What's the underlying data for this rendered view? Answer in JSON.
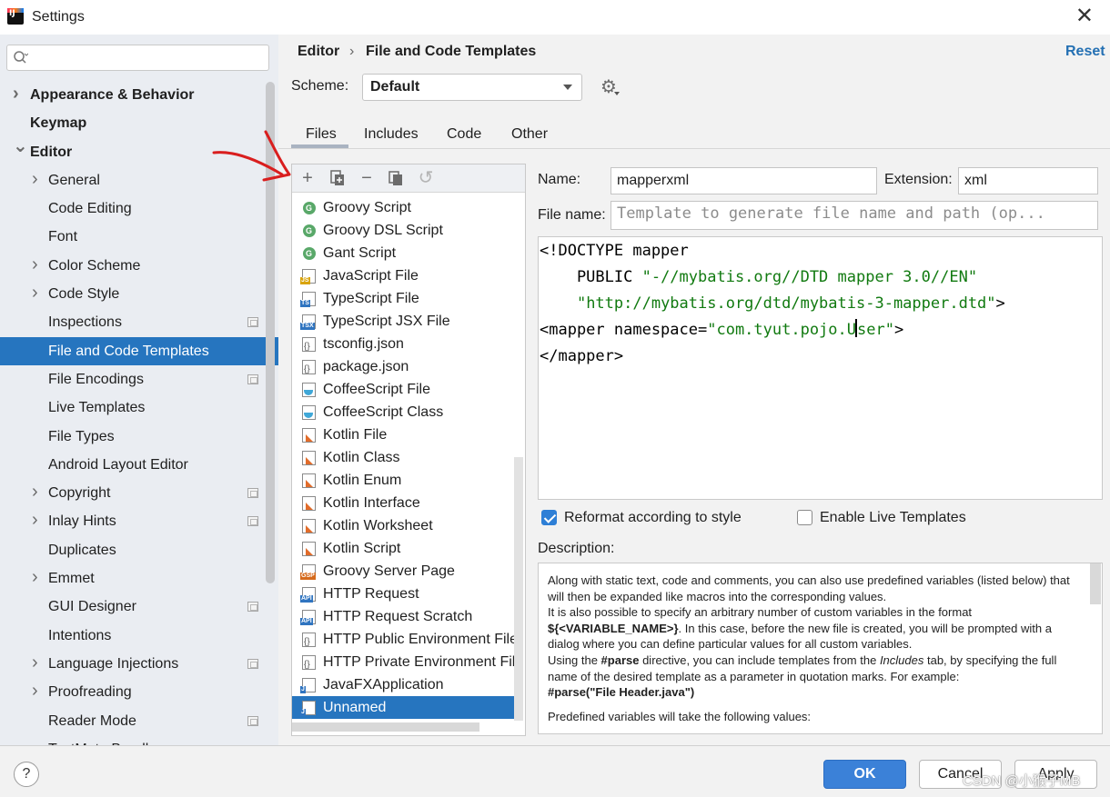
{
  "window": {
    "title": "Settings",
    "close_glyph": "✕"
  },
  "sidebar": {
    "search_placeholder": "",
    "items": [
      {
        "label": "Appearance & Behavior",
        "bold": true,
        "chevron": "right",
        "level": 0
      },
      {
        "label": "Keymap",
        "bold": true,
        "chevron": "none",
        "level": 0
      },
      {
        "label": "Editor",
        "bold": true,
        "chevron": "down",
        "level": 0
      },
      {
        "label": "General",
        "chevron": "right",
        "level": 1
      },
      {
        "label": "Code Editing",
        "chevron": "none",
        "level": 1
      },
      {
        "label": "Font",
        "chevron": "none",
        "level": 1
      },
      {
        "label": "Color Scheme",
        "chevron": "right",
        "level": 1
      },
      {
        "label": "Code Style",
        "chevron": "right",
        "level": 1
      },
      {
        "label": "Inspections",
        "chevron": "none",
        "level": 1,
        "badge": true
      },
      {
        "label": "File and Code Templates",
        "chevron": "none",
        "level": 1,
        "selected": true
      },
      {
        "label": "File Encodings",
        "chevron": "none",
        "level": 1,
        "badge": true
      },
      {
        "label": "Live Templates",
        "chevron": "none",
        "level": 1
      },
      {
        "label": "File Types",
        "chevron": "none",
        "level": 1
      },
      {
        "label": "Android Layout Editor",
        "chevron": "none",
        "level": 1
      },
      {
        "label": "Copyright",
        "chevron": "right",
        "level": 1,
        "badge": true
      },
      {
        "label": "Inlay Hints",
        "chevron": "right",
        "level": 1,
        "badge": true
      },
      {
        "label": "Duplicates",
        "chevron": "none",
        "level": 1
      },
      {
        "label": "Emmet",
        "chevron": "right",
        "level": 1
      },
      {
        "label": "GUI Designer",
        "chevron": "none",
        "level": 1,
        "badge": true
      },
      {
        "label": "Intentions",
        "chevron": "none",
        "level": 1
      },
      {
        "label": "Language Injections",
        "chevron": "right",
        "level": 1,
        "badge": true
      },
      {
        "label": "Proofreading",
        "chevron": "right",
        "level": 1
      },
      {
        "label": "Reader Mode",
        "chevron": "none",
        "level": 1,
        "badge": true
      },
      {
        "label": "TextMate Bundles",
        "chevron": "none",
        "level": 1
      }
    ]
  },
  "breadcrumb": {
    "parent": "Editor",
    "separator": "›",
    "current": "File and Code Templates"
  },
  "reset_label": "Reset",
  "scheme": {
    "label": "Scheme:",
    "value": "Default"
  },
  "tabs": [
    "Files",
    "Includes",
    "Code",
    "Other"
  ],
  "active_tab": "Files",
  "toolbar": {
    "add": "+",
    "copy": "⧉",
    "remove": "−",
    "duplicate": "❐",
    "reset": "↺"
  },
  "templates": [
    {
      "label": "Groovy Script",
      "icon": "groovy-icon"
    },
    {
      "label": "Groovy DSL Script",
      "icon": "groovy-icon"
    },
    {
      "label": "Gant Script",
      "icon": "groovy-icon"
    },
    {
      "label": "JavaScript File",
      "icon": "javascript-file-icon",
      "tag": "JS",
      "tag_color": "#d9a40c"
    },
    {
      "label": "TypeScript File",
      "icon": "typescript-file-icon",
      "tag": "TS",
      "tag_color": "#2f74c0"
    },
    {
      "label": "TypeScript JSX File",
      "icon": "tsx-file-icon",
      "tag": "TSX",
      "tag_color": "#2f74c0"
    },
    {
      "label": "tsconfig.json",
      "icon": "json-file-icon"
    },
    {
      "label": "package.json",
      "icon": "json-file-icon"
    },
    {
      "label": "CoffeeScript File",
      "icon": "coffeescript-icon"
    },
    {
      "label": "CoffeeScript Class",
      "icon": "coffeescript-icon"
    },
    {
      "label": "Kotlin File",
      "icon": "kotlin-icon"
    },
    {
      "label": "Kotlin Class",
      "icon": "kotlin-icon"
    },
    {
      "label": "Kotlin Enum",
      "icon": "kotlin-icon"
    },
    {
      "label": "Kotlin Interface",
      "icon": "kotlin-icon"
    },
    {
      "label": "Kotlin Worksheet",
      "icon": "kotlin-icon"
    },
    {
      "label": "Kotlin Script",
      "icon": "kotlin-icon"
    },
    {
      "label": "Groovy Server Page",
      "icon": "gsp-file-icon",
      "tag": "GSP",
      "tag_color": "#d56a1c"
    },
    {
      "label": "HTTP Request",
      "icon": "http-file-icon",
      "tag": "API",
      "tag_color": "#2f74c0"
    },
    {
      "label": "HTTP Request Scratch",
      "icon": "http-file-icon",
      "tag": "API",
      "tag_color": "#2f74c0"
    },
    {
      "label": "HTTP Public Environment File",
      "icon": "json-file-icon"
    },
    {
      "label": "HTTP Private Environment File",
      "icon": "json-file-icon"
    },
    {
      "label": "JavaFXApplication",
      "icon": "java-file-icon",
      "tag": "J",
      "tag_color": "#2f74c0"
    },
    {
      "label": "Unnamed",
      "icon": "java-file-icon",
      "tag": "J",
      "tag_color": "#2f74c0",
      "selected": true
    }
  ],
  "form": {
    "name_label": "Name:",
    "name_value": "mapperxml",
    "extension_label": "Extension:",
    "extension_value": "xml",
    "filename_label": "File name:",
    "filename_placeholder": "Template to generate file name and path (op..."
  },
  "code_lines": [
    [
      {
        "t": "<!DOCTYPE mapper",
        "c": "tag"
      }
    ],
    [
      {
        "t": "    PUBLIC ",
        "c": "tag"
      },
      {
        "t": "\"-//mybatis.org//DTD mapper 3.0//EN\"",
        "c": "str"
      }
    ],
    [
      {
        "t": "    ",
        "c": "tag"
      },
      {
        "t": "\"http://mybatis.org/dtd/mybatis-3-mapper.dtd\"",
        "c": "str"
      },
      {
        "t": ">",
        "c": "tag"
      }
    ],
    [
      {
        "t": "<mapper namespace=",
        "c": "tag"
      },
      {
        "t": "\"com.tyut.pojo.U",
        "c": "str"
      },
      {
        "t": "",
        "c": "caret"
      },
      {
        "t": "ser\"",
        "c": "str"
      },
      {
        "t": ">",
        "c": "tag"
      }
    ],
    [
      {
        "t": "</mapper>",
        "c": "tag"
      }
    ]
  ],
  "options": {
    "reformat_label": "Reformat according to style",
    "reformat_checked": true,
    "live_templates_label": "Enable Live Templates",
    "live_templates_checked": false
  },
  "description": {
    "label": "Description:",
    "paragraphs": [
      [
        {
          "t": "Along with static text, code and comments, you can also use predefined variables (listed below) that will then be expanded like macros into the corresponding values."
        }
      ],
      [
        {
          "t": "It is also possible to specify an arbitrary number of custom variables in the format "
        },
        {
          "t": "${<VARIABLE_NAME>}",
          "b": true
        },
        {
          "t": ". In this case, before the new file is created, you will be prompted with a dialog where you can define particular values for all custom variables."
        }
      ],
      [
        {
          "t": "Using the "
        },
        {
          "t": "#parse",
          "b": true
        },
        {
          "t": " directive, you can include templates from the "
        },
        {
          "t": "Includes",
          "i": true
        },
        {
          "t": " tab, by specifying the full name of the desired template as a parameter in quotation marks. For example:"
        }
      ],
      [
        {
          "t": "#parse(\"File Header.java\")",
          "b": true
        }
      ],
      [
        {
          "t": "",
          "spacer": true
        }
      ],
      [
        {
          "t": "Predefined variables will take the following values:"
        }
      ]
    ]
  },
  "footer": {
    "help": "?",
    "ok": "OK",
    "cancel": "Cancel",
    "apply": "Apply",
    "watermark": "CSDN @小猴子MB"
  },
  "colors": {
    "accent": "#2675bf",
    "string": "#117a10",
    "link": "#2470b3",
    "annotation": "#d91e1e"
  }
}
